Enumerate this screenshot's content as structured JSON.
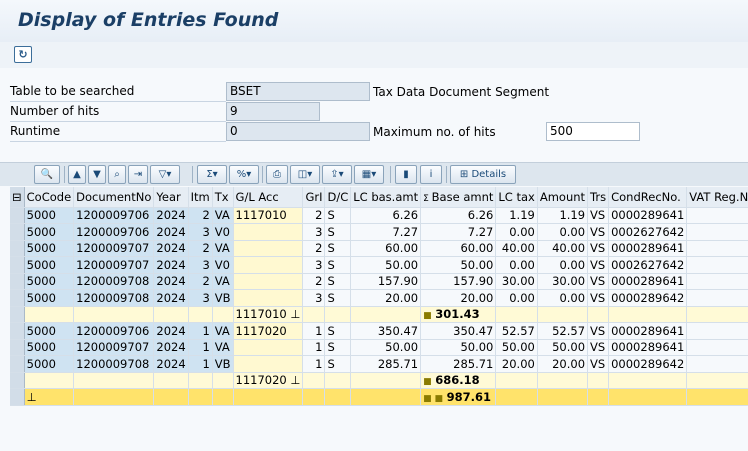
{
  "window": {
    "title": "Display of Entries Found"
  },
  "form": {
    "table_label": "Table to be searched",
    "table_value": "BSET",
    "table_desc": "Tax Data Document Segment",
    "hits_label": "Number of hits",
    "hits_value": "9",
    "runtime_label": "Runtime",
    "runtime_value": "0",
    "maxhits_label": "Maximum no. of hits",
    "maxhits_value": "500"
  },
  "toolbar": {
    "details_label": "Details"
  },
  "table": {
    "headers": [
      "CoCode",
      "DocumentNo",
      "Year",
      "Itm",
      "Tx",
      "G/L Acc",
      "GrI",
      "D/C",
      "LC bas.amt",
      "Base amnt",
      "LC tax",
      "Amount",
      "Trs",
      "CondRecNo.",
      "VAT Reg.N"
    ],
    "sum_marker": "Σ",
    "group1": [
      [
        "5000",
        "1200009706",
        "2024",
        "2",
        "VA",
        "1117010",
        "2",
        "S",
        "6.26",
        "6.26",
        "1.19",
        "1.19",
        "VS",
        "0000289641"
      ],
      [
        "5000",
        "1200009706",
        "2024",
        "3",
        "V0",
        "",
        "3",
        "S",
        "7.27",
        "7.27",
        "0.00",
        "0.00",
        "VS",
        "0002627642"
      ],
      [
        "5000",
        "1200009707",
        "2024",
        "2",
        "VA",
        "",
        "2",
        "S",
        "60.00",
        "60.00",
        "40.00",
        "40.00",
        "VS",
        "0000289641"
      ],
      [
        "5000",
        "1200009707",
        "2024",
        "3",
        "V0",
        "",
        "3",
        "S",
        "50.00",
        "50.00",
        "0.00",
        "0.00",
        "VS",
        "0002627642"
      ],
      [
        "5000",
        "1200009708",
        "2024",
        "2",
        "VA",
        "",
        "2",
        "S",
        "157.90",
        "157.90",
        "30.00",
        "30.00",
        "VS",
        "0000289641"
      ],
      [
        "5000",
        "1200009708",
        "2024",
        "3",
        "VB",
        "",
        "3",
        "S",
        "20.00",
        "20.00",
        "0.00",
        "0.00",
        "VS",
        "0000289642"
      ]
    ],
    "subtotal1": {
      "account": "1117010",
      "value": "301.43"
    },
    "group2": [
      [
        "5000",
        "1200009706",
        "2024",
        "1",
        "VA",
        "1117020",
        "1",
        "S",
        "350.47",
        "350.47",
        "52.57",
        "52.57",
        "VS",
        "0000289641"
      ],
      [
        "5000",
        "1200009707",
        "2024",
        "1",
        "VA",
        "",
        "1",
        "S",
        "50.00",
        "50.00",
        "50.00",
        "50.00",
        "VS",
        "0000289641"
      ],
      [
        "5000",
        "1200009708",
        "2024",
        "1",
        "VB",
        "",
        "1",
        "S",
        "285.71",
        "285.71",
        "20.00",
        "20.00",
        "VS",
        "0000289642"
      ]
    ],
    "subtotal2": {
      "account": "1117020",
      "value": "686.18"
    },
    "total": {
      "value": "987.61"
    }
  }
}
